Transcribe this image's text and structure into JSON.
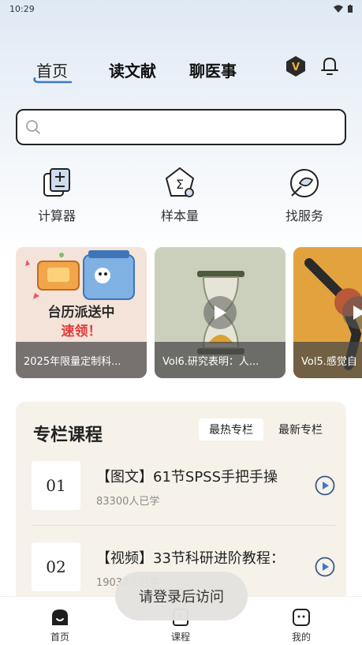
{
  "status": {
    "time": "10:29",
    "wifi_icon": "wifi-icon",
    "battery_icon": "battery-icon"
  },
  "header": {
    "tabs": [
      {
        "label": "首页",
        "active": true
      },
      {
        "label": "读文献",
        "active": false
      },
      {
        "label": "聊医事",
        "active": false
      }
    ],
    "vip_letter": "V"
  },
  "search": {
    "placeholder": "",
    "value": ""
  },
  "tools": [
    {
      "label": "计算器",
      "icon": "calculator-icon"
    },
    {
      "label": "样本量",
      "icon": "sigma-icon"
    },
    {
      "label": "找服务",
      "icon": "service-icon"
    }
  ],
  "banners": [
    {
      "caption": "2025年限量定制科...",
      "poster_line1": "台历派送中",
      "poster_line2": "速领！"
    },
    {
      "caption": "Vol6.研究表明：人..."
    },
    {
      "caption": "Vol5.感觉自"
    }
  ],
  "courses": {
    "title": "专栏课程",
    "tabs": [
      {
        "label": "最热专栏",
        "active": true
      },
      {
        "label": "最新专栏",
        "active": false
      }
    ],
    "items": [
      {
        "num": "01",
        "title": "【图文】61节SPSS手把手操",
        "meta": "83300人已学"
      },
      {
        "num": "02",
        "title": "【视频】33节科研进阶教程：",
        "meta": "19033人已学"
      }
    ]
  },
  "toast": "请登录后访问",
  "bottom_nav": [
    {
      "label": "首页",
      "icon": "home-icon"
    },
    {
      "label": "课程",
      "icon": "course-icon"
    },
    {
      "label": "我的",
      "icon": "profile-icon"
    }
  ],
  "colors": {
    "accent_blue": "#3c79c8",
    "gold": "#e8b23a",
    "panel_bg": "#f6f2ea"
  }
}
